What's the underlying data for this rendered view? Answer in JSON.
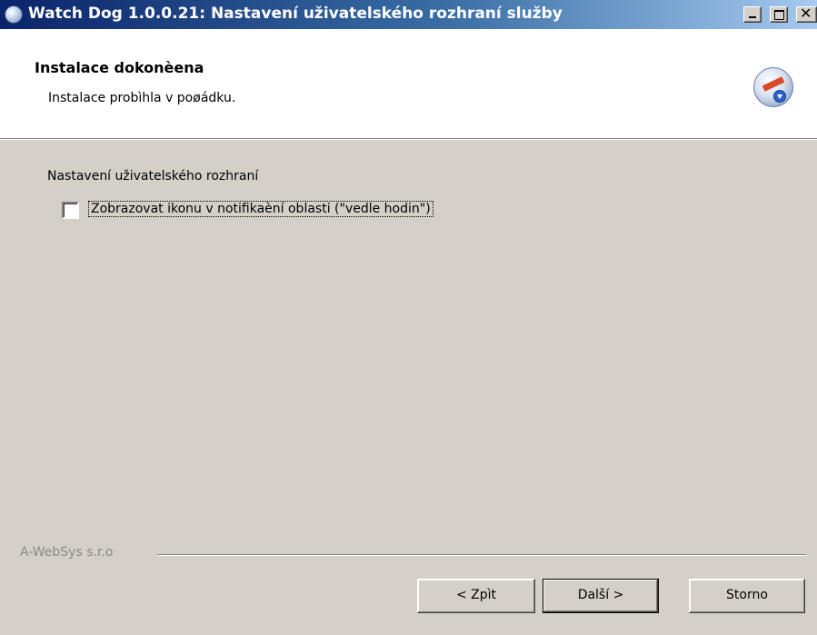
{
  "window": {
    "title": "Watch Dog 1.0.0.21: Nastavení uživatelského rozhraní služby",
    "controls": {
      "minimize": "_",
      "maximize": "□",
      "close": "×"
    }
  },
  "header": {
    "title": "Instalace dokonèena",
    "subtitle": "Instalace probìhla v poøádku."
  },
  "content": {
    "group_label": "Nastavení uživatelského rozhraní",
    "checkbox": {
      "label": "Zobrazovat ikonu v notifikaèní oblasti (\"vedle hodin\")",
      "checked": false
    }
  },
  "footer": {
    "brand": "A-WebSys s.r.o",
    "buttons": {
      "back": "< Zpìt",
      "next": "Další >",
      "cancel": "Storno"
    }
  }
}
